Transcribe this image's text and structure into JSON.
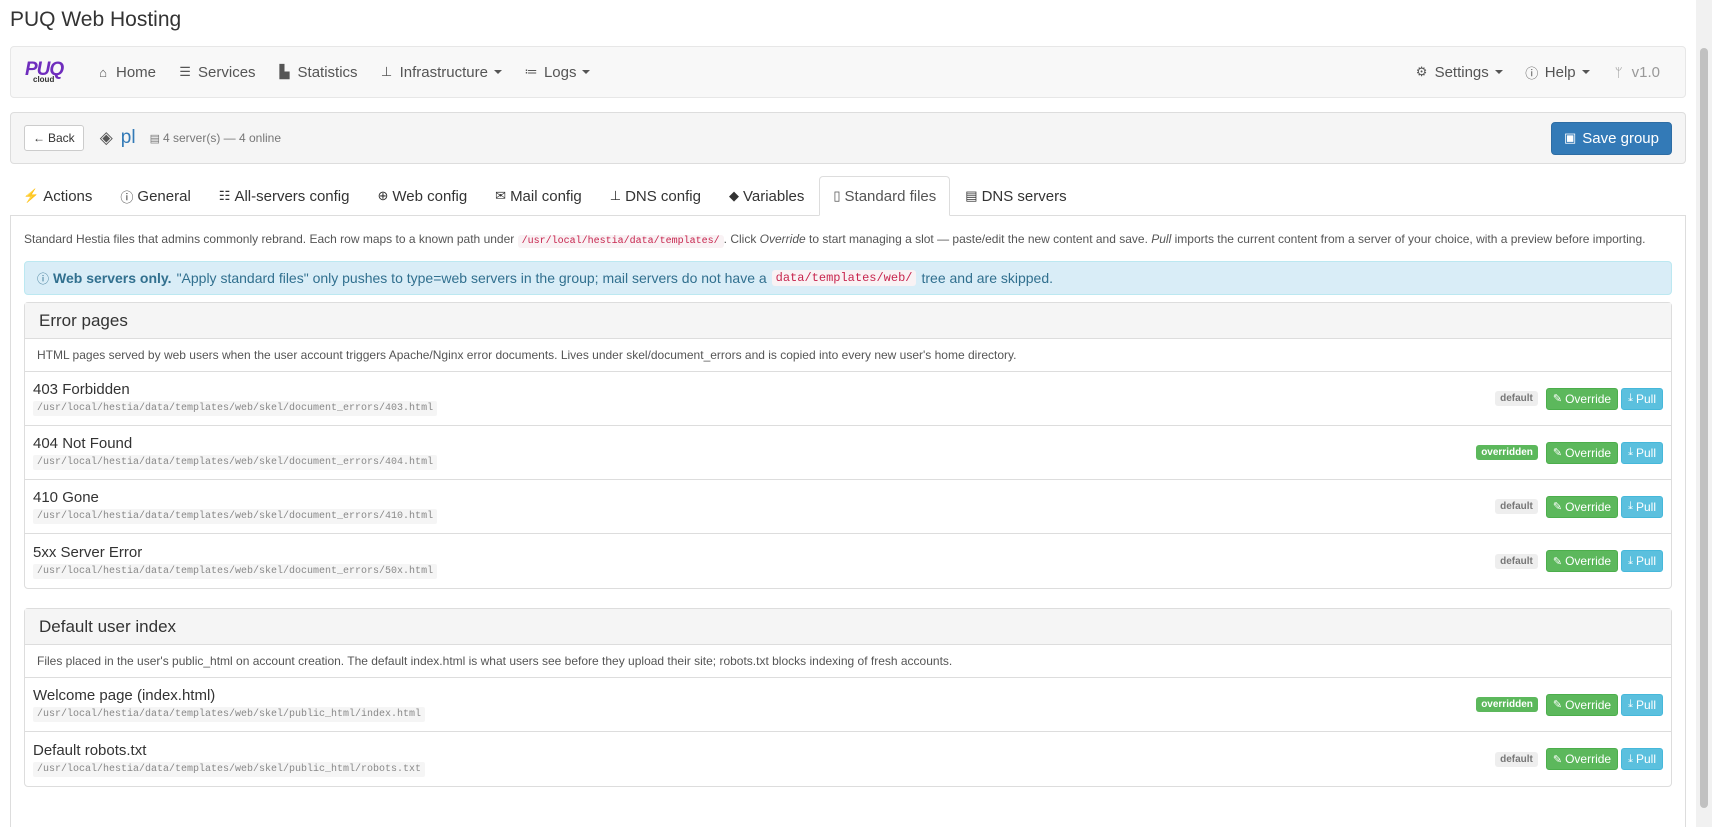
{
  "app": {
    "title": "PUQ Web Hosting"
  },
  "navbar": {
    "brand_main": "PUQ",
    "brand_sub": "cloud",
    "items": [
      {
        "label": "Home",
        "icon": "home-icon"
      },
      {
        "label": "Services",
        "icon": "list-icon"
      },
      {
        "label": "Statistics",
        "icon": "chart-icon"
      },
      {
        "label": "Infrastructure",
        "icon": "sitemap-icon"
      },
      {
        "label": "Logs",
        "icon": "tasks-icon"
      }
    ],
    "right": [
      {
        "label": "Settings",
        "icon": "gear-icon"
      },
      {
        "label": "Help",
        "icon": "info-icon"
      },
      {
        "label": "v1.0",
        "icon": "branch-icon"
      }
    ]
  },
  "group": {
    "back_label": "Back",
    "name": "pl",
    "server_status": "4 server(s) — 4 online",
    "save_label": "Save group"
  },
  "tabs": [
    {
      "label": "Actions",
      "icon": "bolt-icon"
    },
    {
      "label": "General",
      "icon": "info-circle-icon"
    },
    {
      "label": "All-servers config",
      "icon": "sliders-icon"
    },
    {
      "label": "Web config",
      "icon": "globe-icon"
    },
    {
      "label": "Mail config",
      "icon": "envelope-icon"
    },
    {
      "label": "DNS config",
      "icon": "sitemap-icon"
    },
    {
      "label": "Variables",
      "icon": "tags-icon"
    },
    {
      "label": "Standard files",
      "icon": "file-icon"
    },
    {
      "label": "DNS servers",
      "icon": "server-icon"
    }
  ],
  "active_tab": "Standard files",
  "intro": {
    "p1": "Standard Hestia files that admins commonly rebrand. Each row maps to a known path under",
    "code": "/usr/local/hestia/data/templates/",
    "p2": ". Click",
    "em1": "Override",
    "p3": "to start managing a slot — paste/edit the new content and save.",
    "em2": "Pull",
    "p4": "imports the current content from a server of your choice, with a preview before importing."
  },
  "alert": {
    "strong": "Web servers only.",
    "p1": "\"Apply standard files\" only pushes to type=web servers in the group; mail servers do not have a",
    "code": "data/templates/web/",
    "p2": "tree and are skipped."
  },
  "buttons": {
    "override": "Override",
    "pull": "Pull"
  },
  "sections": [
    {
      "title": "Error pages",
      "description": "HTML pages served by web users when the user account triggers Apache/Nginx error documents. Lives under skel/document_errors and is copied into every new user's home directory.",
      "rows": [
        {
          "name": "403 Forbidden",
          "path": "/usr/local/hestia/data/templates/web/skel/document_errors/403.html",
          "status": "default"
        },
        {
          "name": "404 Not Found",
          "path": "/usr/local/hestia/data/templates/web/skel/document_errors/404.html",
          "status": "overridden"
        },
        {
          "name": "410 Gone",
          "path": "/usr/local/hestia/data/templates/web/skel/document_errors/410.html",
          "status": "default"
        },
        {
          "name": "5xx Server Error",
          "path": "/usr/local/hestia/data/templates/web/skel/document_errors/50x.html",
          "status": "default"
        }
      ]
    },
    {
      "title": "Default user index",
      "description": "Files placed in the user's public_html on account creation. The default index.html is what users see before they upload their site; robots.txt blocks indexing of fresh accounts.",
      "rows": [
        {
          "name": "Welcome page (index.html)",
          "path": "/usr/local/hestia/data/templates/web/skel/public_html/index.html",
          "status": "overridden"
        },
        {
          "name": "Default robots.txt",
          "path": "/usr/local/hestia/data/templates/web/skel/public_html/robots.txt",
          "status": "default"
        }
      ]
    }
  ]
}
